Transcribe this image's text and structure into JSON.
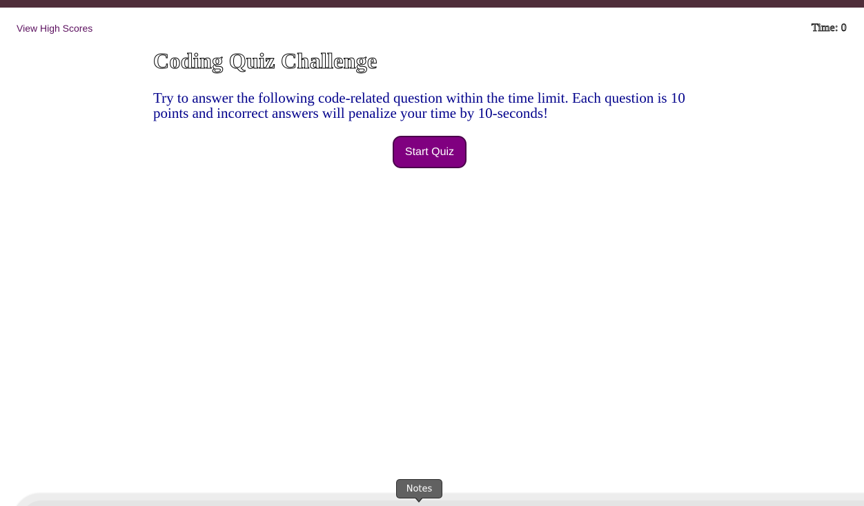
{
  "header": {
    "high_scores_label": "View High Scores",
    "timer_text": "Time: 0"
  },
  "main": {
    "title": "Coding Quiz Challenge",
    "instructions": "Try to answer the following code-related question within the time limit. Each question is 10 points and incorrect answers will penalize your time by 10-seconds!",
    "start_button_label": "Start Quiz"
  },
  "dock": {
    "tooltip_label": "Notes"
  },
  "colors": {
    "top_band": "#4f2e3a",
    "link": "#5b0f5e",
    "instructions_text": "#00008b",
    "button_bg": "#800080"
  }
}
